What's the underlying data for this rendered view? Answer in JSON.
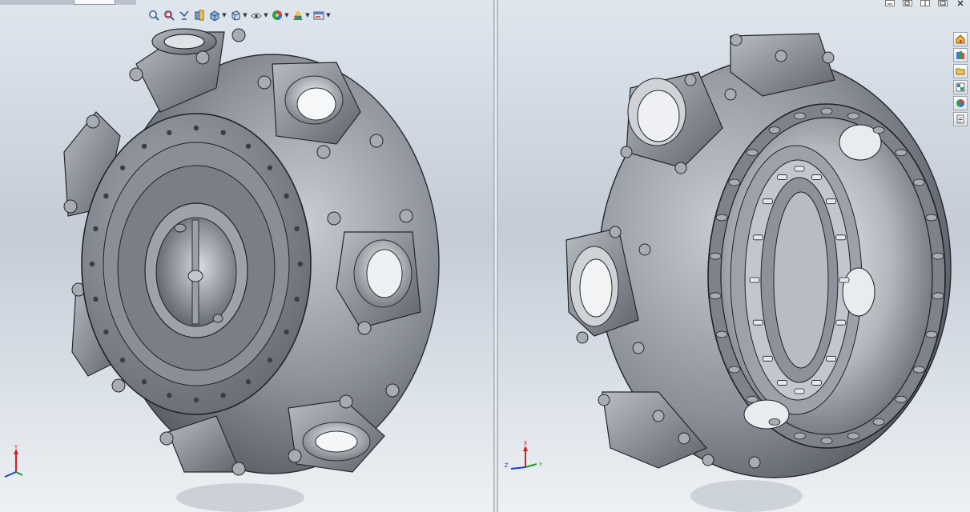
{
  "app": {
    "split_view": "two viewports",
    "background_top": "#dfe6ee",
    "background_mid": "#c3ccd7",
    "background_bottom": "#eef1f4",
    "part_color": "#8c9199"
  },
  "heads_up_toolbar": {
    "icons": [
      "zoom-to-fit-icon",
      "zoom-area-icon",
      "previous-view-icon",
      "section-view-icon",
      "view-orientation-icon",
      "display-style-icon",
      "hide-show-icon",
      "edit-appearance-icon",
      "apply-scene-icon",
      "view-settings-icon"
    ]
  },
  "window_controls": {
    "icons": [
      "minimize-icon",
      "restore-icon",
      "tile-icon",
      "maximize-icon",
      "close-icon"
    ]
  },
  "task_pane": {
    "icons": [
      "solidworks-resources-icon",
      "design-library-icon",
      "file-explorer-icon",
      "view-palette-icon",
      "appearances-icon",
      "custom-properties-icon"
    ]
  },
  "triad_left": {
    "x_label": "X",
    "y_label": "Y",
    "z_label": "Z"
  },
  "triad_right": {
    "x_label": "X",
    "y_label": "Y",
    "z_label": "Z"
  }
}
